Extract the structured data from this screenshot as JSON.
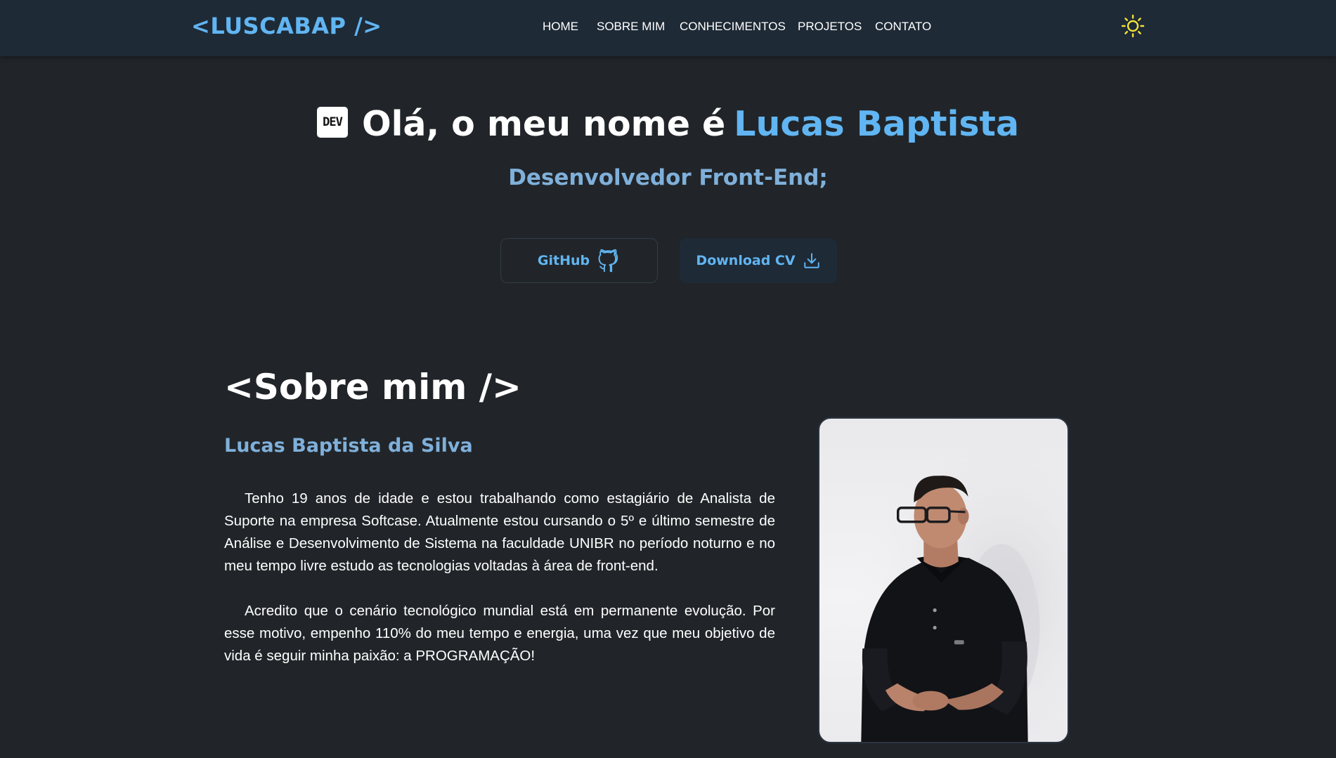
{
  "navbar": {
    "logo": "<LUSCABAP />",
    "links": [
      "HOME",
      "SOBRE MIM",
      "CONHECIMENTOS",
      "PROJETOS",
      "CONTATO"
    ],
    "theme_icon": "sun-icon"
  },
  "hero": {
    "badge": "DEV",
    "greeting": "Olá, o meu nome é",
    "name": "Lucas Baptista",
    "subtitle": "Desenvolvedor Front-End;",
    "buttons": {
      "github_label": "GitHub",
      "github_icon": "github-icon",
      "cv_label": "Download CV",
      "cv_icon": "download-icon"
    }
  },
  "about": {
    "title": "<Sobre mim />",
    "full_name": "Lucas Baptista da Silva",
    "paragraphs": [
      "Tenho 19 anos de idade e estou trabalhando como estagiário de Analista de Suporte na empresa Softcase. Atualmente estou cursando o 5º e último semestre de Análise e Desenvolvimento de Sistema na faculdade UNIBR no período noturno e no meu tempo livre estudo as tecnologias voltadas à área de front-end.",
      "Acredito que o cenário tecnológico mundial está em permanente evolução. Por esse motivo, empenho 110% do meu tempo e energia, uma vez que meu objetivo de vida é seguir minha paixão: a PROGRAMAÇÃO!"
    ]
  },
  "colors": {
    "background": "#212529",
    "navbar": "#1e2a36",
    "accent": "#61b5f2",
    "subtitle": "#7fb0da",
    "sun": "#f2e33a"
  }
}
